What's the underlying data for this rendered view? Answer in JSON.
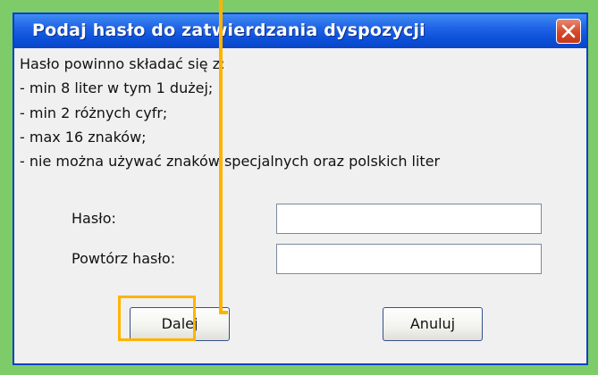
{
  "dialog": {
    "title": "Podaj hasło do zatwierdzania dyspozycji",
    "description_lines": [
      "Hasło powinno składać się z:",
      "- min 8 liter w tym 1 dużej;",
      "- min 2 różnych cyfr;",
      "- max 16 znaków;",
      "- nie można używać znaków specjalnych oraz polskich liter"
    ],
    "password_label": "Hasło:",
    "password_value": "",
    "repeat_label": "Powtórz hasło:",
    "repeat_value": "",
    "next_button": "Dalej",
    "cancel_button": "Anuluj"
  },
  "icons": {
    "close": "close-icon"
  },
  "colors": {
    "background": "#7ecb6a",
    "titlebar": "#1f63e6",
    "close_button": "#d6472a",
    "highlight": "#ffb300"
  }
}
